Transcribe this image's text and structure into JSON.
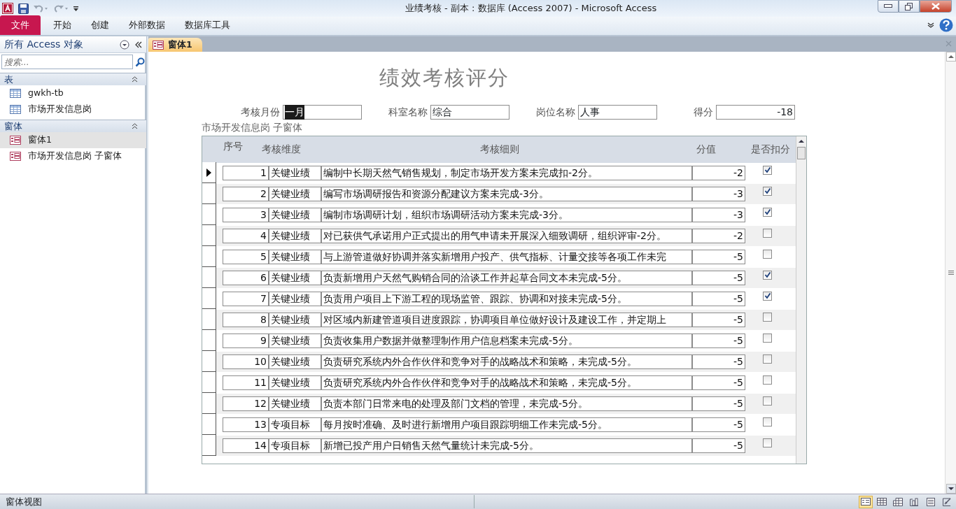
{
  "window": {
    "title": "业绩考核 - 副本 : 数据库 (Access 2007)  -  Microsoft Access"
  },
  "ribbon_tabs": [
    {
      "label": "文件",
      "selected": true
    },
    {
      "label": "开始",
      "selected": false
    },
    {
      "label": "创建",
      "selected": false
    },
    {
      "label": "外部数据",
      "selected": false
    },
    {
      "label": "数据库工具",
      "selected": false
    }
  ],
  "nav_pane": {
    "title": "所有 Access 对象",
    "search": {
      "placeholder": "搜索..."
    },
    "groups": [
      {
        "label": "表",
        "items": [
          {
            "label": "gwkh-tb",
            "kind": "table",
            "selected": false
          },
          {
            "label": "市场开发信息岗",
            "kind": "table",
            "selected": false
          }
        ]
      },
      {
        "label": "窗体",
        "items": [
          {
            "label": "窗体1",
            "kind": "form",
            "selected": true
          },
          {
            "label": "市场开发信息岗 子窗体",
            "kind": "form",
            "selected": false
          }
        ]
      }
    ]
  },
  "document_tabs": [
    {
      "label": "窗体1",
      "selected": true
    }
  ],
  "form": {
    "title": "绩效考核评分",
    "fields": [
      {
        "label": "考核月份",
        "value": "一月",
        "focused": true,
        "kind": "text"
      },
      {
        "label": "科室名称",
        "value": "综合",
        "focused": false,
        "kind": "text"
      },
      {
        "label": "岗位名称",
        "value": "人事",
        "focused": false,
        "kind": "text"
      },
      {
        "label": "得分",
        "value": "-18",
        "focused": false,
        "kind": "number"
      }
    ],
    "subform": {
      "label": "市场开发信息岗  子窗体",
      "columns": [
        "序号",
        "考核维度",
        "考核细则",
        "分值",
        "是否扣分"
      ],
      "rows": [
        {
          "no": "1",
          "dimension": "关键业绩",
          "rule": "编制中长期天然气销售规划，制定市场开发方案未完成扣-2分。",
          "score": "-2",
          "checked": true,
          "selected": true
        },
        {
          "no": "2",
          "dimension": "关键业绩",
          "rule": "编写市场调研报告和资源分配建议方案未完成-3分。",
          "score": "-3",
          "checked": true,
          "selected": false
        },
        {
          "no": "3",
          "dimension": "关键业绩",
          "rule": "编制市场调研计划，组织市场调研活动方案未完成-3分。",
          "score": "-3",
          "checked": true,
          "selected": false
        },
        {
          "no": "4",
          "dimension": "关键业绩",
          "rule": "对已获供气承诺用户正式提出的用气申请未开展深入细致调研，组织评审-2分。",
          "score": "-2",
          "checked": false,
          "selected": false
        },
        {
          "no": "5",
          "dimension": "关键业绩",
          "rule": "与上游管道做好协调并落实新增用户投产、供气指标、计量交接等各项工作未完",
          "score": "-5",
          "checked": false,
          "selected": false
        },
        {
          "no": "6",
          "dimension": "关键业绩",
          "rule": "负责新增用户天然气购销合同的洽谈工作并起草合同文本未完成-5分。",
          "score": "-5",
          "checked": true,
          "selected": false
        },
        {
          "no": "7",
          "dimension": "关键业绩",
          "rule": "负责用户项目上下游工程的现场监管、跟踪、协调和对接未完成-5分。",
          "score": "-5",
          "checked": true,
          "selected": false
        },
        {
          "no": "8",
          "dimension": "关键业绩",
          "rule": "对区域内新建管道项目进度跟踪，协调项目单位做好设计及建设工作，并定期上",
          "score": "-5",
          "checked": false,
          "selected": false
        },
        {
          "no": "9",
          "dimension": "关键业绩",
          "rule": "负责收集用户数据并做整理制作用户信息档案未完成-5分。",
          "score": "-5",
          "checked": false,
          "selected": false
        },
        {
          "no": "10",
          "dimension": "关键业绩",
          "rule": "负责研究系统内外合作伙伴和竞争对手的战略战术和策略，未完成-5分。",
          "score": "-5",
          "checked": false,
          "selected": false
        },
        {
          "no": "11",
          "dimension": "关键业绩",
          "rule": "负责研究系统内外合作伙伴和竞争对手的战略战术和策略，未完成-5分。",
          "score": "-5",
          "checked": false,
          "selected": false
        },
        {
          "no": "12",
          "dimension": "关键业绩",
          "rule": "负责本部门日常来电的处理及部门文档的管理，未完成-5分。",
          "score": "-5",
          "checked": false,
          "selected": false
        },
        {
          "no": "13",
          "dimension": "专项目标",
          "rule": "每月按时准确、及时进行新增用户项目跟踪明细工作未完成-5分。",
          "score": "-5",
          "checked": false,
          "selected": false
        },
        {
          "no": "14",
          "dimension": "专项目标",
          "rule": "新增已投产用户日销售天然气量统计未完成-5分。",
          "score": "-5",
          "checked": false,
          "selected": false
        }
      ]
    }
  },
  "status_bar": {
    "text": "窗体视图",
    "views": [
      {
        "selected": true
      },
      {
        "selected": false
      },
      {
        "selected": false
      },
      {
        "selected": false
      },
      {
        "selected": false
      },
      {
        "selected": false
      }
    ]
  }
}
